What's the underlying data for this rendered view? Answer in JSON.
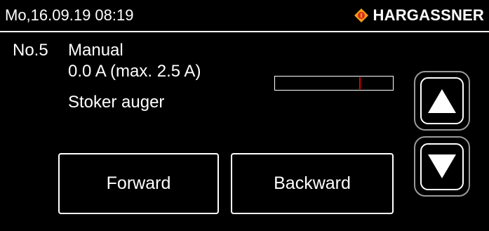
{
  "header": {
    "datetime": "Mo,16.09.19 08:19",
    "brand": "HARGASSNER",
    "logo_icon": "hargassner-flame-diamond-logo"
  },
  "output": {
    "number": "No.5",
    "mode": "Manual",
    "current": "0.0 A (max. 2.5 A)",
    "name": "Stoker auger",
    "level_fraction": 0.72
  },
  "buttons": {
    "forward": "Forward",
    "backward": "Backward",
    "up_icon": "arrow-up-icon",
    "down_icon": "arrow-down-icon"
  },
  "colors": {
    "background": "#000000",
    "text": "#ffffff",
    "marker": "#e00000",
    "logo_orange": "#f39c12",
    "logo_red": "#d9271e"
  }
}
